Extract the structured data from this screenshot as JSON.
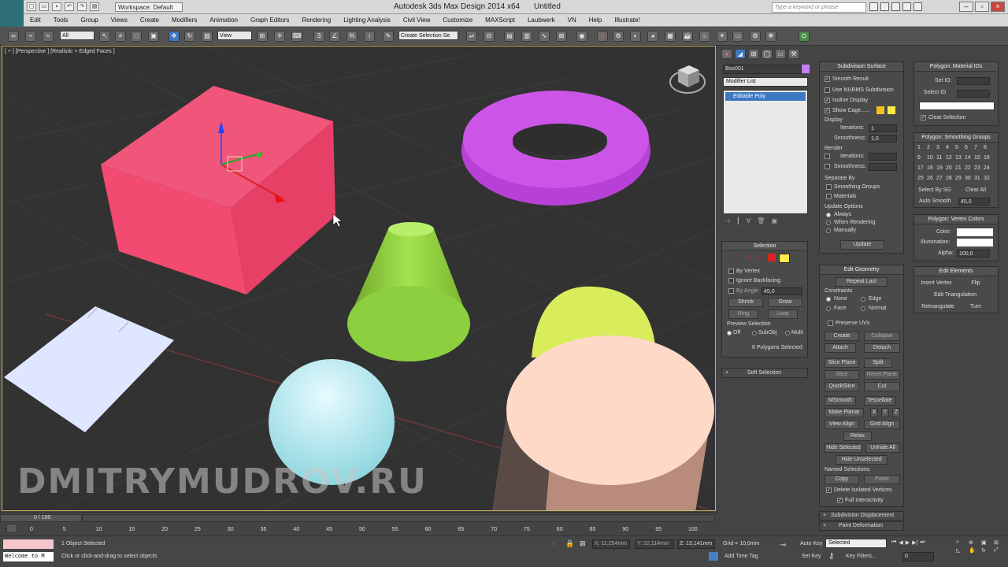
{
  "titlebar": {
    "workspace": "Workspace: Default",
    "title": "Autodesk 3ds Max Design 2014 x64",
    "doc": "Untitled",
    "search_placeholder": "Type a keyword or phrase"
  },
  "menu": [
    "Edit",
    "Tools",
    "Group",
    "Views",
    "Create",
    "Modifiers",
    "Animation",
    "Graph Editors",
    "Rendering",
    "Lighting Analysis",
    "Civil View",
    "Customize",
    "MAXScript",
    "Laubwerk",
    "VN",
    "Help",
    "Illustrate!"
  ],
  "toolbar": {
    "filter": "All",
    "coord": "View",
    "named_sel": "Create Selection Se"
  },
  "viewport": {
    "label": "[ + ] [Perspective ] [Realistic + Edged Faces ]",
    "watermark": "DMITRYMUDROV.RU"
  },
  "cmd": {
    "object_name": "Box001",
    "modifier_list": "Modifier List",
    "stack_item": "Editable Poly",
    "selection": {
      "title": "Selection",
      "by_vertex": "By Vertex",
      "ignore_backfacing": "Ignore Backfacing",
      "by_angle": "By Angle:",
      "angle_val": "45,0",
      "shrink": "Shrink",
      "grow": "Grow",
      "ring": "Ring",
      "loop": "Loop",
      "preview": "Preview Selection",
      "off": "Off",
      "subobj": "SubObj",
      "multi": "Multi",
      "status": "6 Polygons Selected"
    },
    "soft_selection": "Soft Selection",
    "subdiv": {
      "title": "Subdivision Surface",
      "smooth_result": "Smooth Result",
      "nurms": "Use NURMS Subdivision",
      "isoline": "Isoline Display",
      "show_cage": "Show Cage......",
      "display": "Display",
      "iterations": "Iterations:",
      "iter_val": "1",
      "smoothness": "Smoothness:",
      "smooth_val": "1,0",
      "render": "Render",
      "r_iterations": "Iterations:",
      "r_smoothness": "Smoothness:",
      "separate_by": "Separate By",
      "smoothing_groups": "Smoothing Groups",
      "materials": "Materials",
      "update_options": "Update Options",
      "always": "Always",
      "when_rendering": "When Rendering",
      "manually": "Manually",
      "update": "Update"
    },
    "edit_geometry": {
      "title": "Edit Geometry",
      "repeat_last": "Repeat Last",
      "constraints": "Constraints",
      "none": "None",
      "edge": "Edge",
      "face": "Face",
      "normal": "Normal",
      "preserve_uvs": "Preserve UVs",
      "create": "Create",
      "collapse": "Collapse",
      "attach": "Attach",
      "detach": "Detach",
      "slice_plane": "Slice Plane",
      "split": "Split",
      "slice": "Slice",
      "reset_plane": "Reset Plane",
      "quickslice": "QuickSlice",
      "cut": "Cut",
      "msmooth": "MSmooth",
      "tessellate": "Tessellate",
      "make_planar": "Make Planar",
      "x": "X",
      "y": "Y",
      "z": "Z",
      "view_align": "View Align",
      "grid_align": "Grid Align",
      "relax": "Relax",
      "hide_selected": "Hide Selected",
      "unhide_all": "Unhide All",
      "hide_unselected": "Hide Unselected",
      "named_selections": "Named Selections:",
      "copy": "Copy",
      "paste": "Paste",
      "delete_isolated": "Delete Isolated Vertices",
      "full_interactivity": "Full Interactivity"
    },
    "subdiv_displacement": "Subdivision Displacement",
    "paint_deformation": "Paint Deformation",
    "mat_ids": {
      "title": "Polygon: Material IDs",
      "set_id": "Set ID:",
      "select_id": "Select ID",
      "clear_selection": "Clear Selection"
    },
    "smoothing": {
      "title": "Polygon: Smoothing Groups",
      "rows": [
        [
          "1",
          "2",
          "3",
          "4",
          "5",
          "6",
          "7",
          "8"
        ],
        [
          "9",
          "10",
          "11",
          "12",
          "13",
          "14",
          "15",
          "16"
        ],
        [
          "17",
          "18",
          "19",
          "20",
          "21",
          "22",
          "23",
          "24"
        ],
        [
          "25",
          "26",
          "27",
          "28",
          "29",
          "30",
          "31",
          "32"
        ]
      ],
      "select_by_sg": "Select By SG",
      "clear_all": "Clear All",
      "auto_smooth": "Auto Smooth",
      "auto_val": "45,0"
    },
    "vertex_colors": {
      "title": "Polygon: Vertex Colors",
      "color": "Color:",
      "illumination": "Illumination:",
      "alpha": "Alpha:",
      "alpha_val": "100,0"
    },
    "edit_elements": {
      "title": "Edit Elements",
      "insert_vertex": "Insert Vertex",
      "flip": "Flip",
      "edit_triangulation": "Edit Triangulation",
      "retriangulate": "Retriangulate",
      "turn": "Turn"
    }
  },
  "timeline": {
    "frame": "0 / 100",
    "ticks": [
      "0",
      "5",
      "10",
      "15",
      "20",
      "25",
      "30",
      "35",
      "40",
      "45",
      "50",
      "55",
      "60",
      "65",
      "70",
      "75",
      "80",
      "85",
      "90",
      "95",
      "100"
    ]
  },
  "status": {
    "selected": "1 Object Selected",
    "prompt": "Click or click-and-drag to select objects",
    "listener": "Welcome to M",
    "x": "X: 11,254mm",
    "y": "Y: 22,114mm",
    "z": "Z: 13,141mm",
    "grid": "Grid = 10,0mm",
    "add_time_tag": "Add Time Tag",
    "auto_key": "Auto Key",
    "set_key": "Set Key",
    "key_sel": "Selected",
    "key_filters": "Key Filters...",
    "frame_val": "0"
  }
}
